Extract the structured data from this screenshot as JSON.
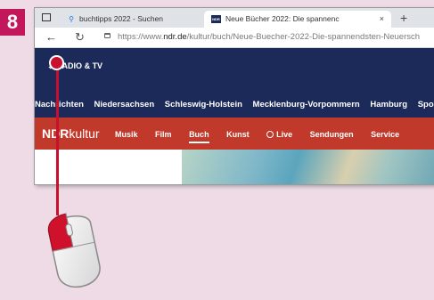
{
  "step": {
    "number": "8"
  },
  "browser": {
    "tabs": [
      {
        "label": "buchtipps 2022 - Suchen",
        "close": "×"
      },
      {
        "label": "Neue Bücher 2022: Die spannenc",
        "close": "×"
      }
    ],
    "new_tab": "+",
    "address": {
      "prefix": "https://www.",
      "domain": "ndr.de",
      "path": "/kultur/buch/Neue-Buecher-2022-Die-spannendsten-Neuersch"
    }
  },
  "site": {
    "radio_tv": "RADIO & TV",
    "main_nav": [
      "Nachrichten",
      "Niedersachsen",
      "Schleswig-Holstein",
      "Mecklenburg-Vorpommern",
      "Hamburg",
      "Sport"
    ],
    "logo": {
      "brand": "NDR",
      "sub": "kultur"
    },
    "kultur_nav": {
      "musik": "Musik",
      "film": "Film",
      "buch": "Buch",
      "kunst": "Kunst",
      "live": "Live",
      "sendungen": "Sendungen",
      "service": "Service"
    }
  },
  "colors": {
    "badge": "#c2185b",
    "ndr_blue": "#1c2a5a",
    "kultur_red": "#c0392b",
    "pointer": "#c8102e"
  }
}
